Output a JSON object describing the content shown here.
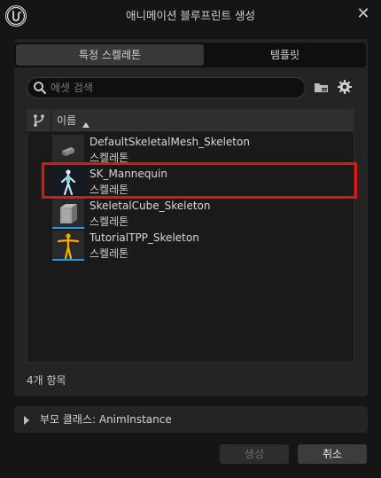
{
  "window": {
    "title": "애니메이션 블루프린트 생성",
    "close_label": "✕"
  },
  "tabs": [
    {
      "label": "특정 스켈레톤",
      "active": true
    },
    {
      "label": "템플릿",
      "active": false
    }
  ],
  "search": {
    "placeholder": "에셋 검색",
    "value": ""
  },
  "list": {
    "column_header": "이름",
    "rows": [
      {
        "name": "DefaultSkeletalMesh_Skeleton",
        "type": "스켈레톤",
        "icon": "skeletal-mesh-thumbnail"
      },
      {
        "name": "SK_Mannequin",
        "type": "스켈레톤",
        "icon": "mannequin-thumbnail",
        "highlighted": true
      },
      {
        "name": "SkeletalCube_Skeleton",
        "type": "스켈레톤",
        "icon": "cube-thumbnail"
      },
      {
        "name": "TutorialTPP_Skeleton",
        "type": "스켈레톤",
        "icon": "tutorial-mannequin-thumbnail"
      }
    ]
  },
  "item_count": "4개 항목",
  "parent_class": {
    "label": "부모 클래스: AnimInstance"
  },
  "buttons": {
    "create_label": "생성",
    "cancel_label": "취소"
  },
  "colors": {
    "highlight": "#e01515",
    "thumbnail_bar": "#1f9be6"
  }
}
